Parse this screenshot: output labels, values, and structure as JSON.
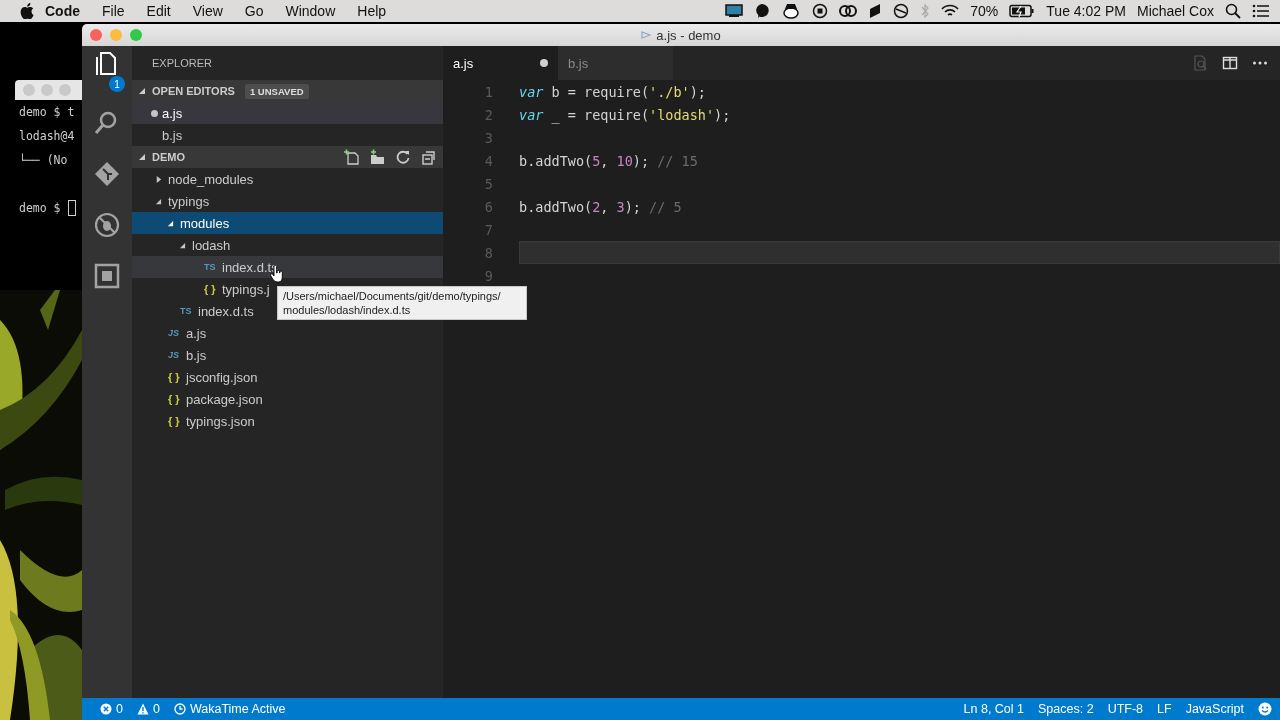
{
  "menubar": {
    "app": "Code",
    "menus": [
      "File",
      "Edit",
      "View",
      "Go",
      "Window",
      "Help"
    ],
    "battery": "70%",
    "clock": "Tue 4:02 PM",
    "user": "Michael Cox"
  },
  "terminal": {
    "lines": [
      "demo $ t",
      "lodash@4",
      "└── (No"
    ],
    "prompt": "demo $"
  },
  "window": {
    "title": "a.js - demo"
  },
  "activity_bar": {
    "items": [
      {
        "kind": "files",
        "selected": true,
        "badge": "1"
      },
      {
        "kind": "search",
        "selected": false
      },
      {
        "kind": "git",
        "selected": false
      },
      {
        "kind": "debug",
        "selected": false
      },
      {
        "kind": "extensions",
        "selected": false
      }
    ]
  },
  "sidebar": {
    "title": "EXPLORER",
    "open_editors": {
      "label": "OPEN EDITORS",
      "badge": "1 UNSAVED",
      "expanded": true,
      "items": [
        {
          "name": "a.js",
          "dirty": true,
          "selected": true
        },
        {
          "name": "b.js",
          "dirty": false,
          "selected": false
        }
      ]
    },
    "project": {
      "label": "DEMO",
      "expanded": true,
      "tree": [
        {
          "name": "node_modules",
          "kind": "folder",
          "expanded": false,
          "selected": false,
          "hovered": false
        },
        {
          "name": "typings",
          "kind": "folder",
          "expanded": true,
          "selected": false,
          "hovered": false,
          "children": [
            {
              "name": "modules",
              "kind": "folder",
              "expanded": true,
              "selected": true,
              "hovered": false,
              "children": [
                {
                  "name": "lodash",
                  "kind": "folder",
                  "expanded": true,
                  "selected": false,
                  "hovered": false,
                  "children": [
                    {
                      "name": "index.d.ts",
                      "kind": "ts",
                      "icon": "TS",
                      "selected": false,
                      "hovered": true
                    },
                    {
                      "name": "typings.j",
                      "kind": "json",
                      "icon": "{ }",
                      "selected": false,
                      "hovered": false
                    }
                  ]
                }
              ]
            },
            {
              "name": "index.d.ts",
              "kind": "ts",
              "icon": "TS",
              "selected": false,
              "hovered": false
            }
          ]
        },
        {
          "name": "a.js",
          "kind": "js",
          "icon": "JS",
          "selected": false,
          "hovered": false
        },
        {
          "name": "b.js",
          "kind": "js",
          "icon": "JS",
          "selected": false,
          "hovered": false
        },
        {
          "name": "jsconfig.json",
          "kind": "json",
          "icon": "{ }",
          "selected": false,
          "hovered": false
        },
        {
          "name": "package.json",
          "kind": "json",
          "icon": "{ }",
          "selected": false,
          "hovered": false
        },
        {
          "name": "typings.json",
          "kind": "json",
          "icon": "{ }",
          "selected": false,
          "hovered": false
        }
      ]
    }
  },
  "tooltip": {
    "lines": [
      "/Users/michael/Documents/git/demo/typings/",
      "modules/lodash/index.d.ts"
    ]
  },
  "editor": {
    "tabs": [
      {
        "label": "a.js",
        "selected": true,
        "dirty": true
      },
      {
        "label": "b.js",
        "selected": false,
        "dirty": false
      }
    ],
    "lines": [
      {
        "number": "1",
        "current": false,
        "tokens": [
          {
            "kind": "keyword",
            "text": "var"
          },
          {
            "kind": "plain",
            "text": " b = require("
          },
          {
            "kind": "string",
            "text": "'./b'"
          },
          {
            "kind": "plain",
            "text": ");"
          }
        ]
      },
      {
        "number": "2",
        "current": false,
        "tokens": [
          {
            "kind": "keyword",
            "text": "var"
          },
          {
            "kind": "plain",
            "text": " _ = require("
          },
          {
            "kind": "string",
            "text": "'lodash'"
          },
          {
            "kind": "plain",
            "text": ");"
          }
        ]
      },
      {
        "number": "3",
        "current": false
      },
      {
        "number": "4",
        "current": false,
        "tokens": [
          {
            "kind": "plain",
            "text": "b.addTwo("
          },
          {
            "kind": "number",
            "text": "5"
          },
          {
            "kind": "plain",
            "text": ", "
          },
          {
            "kind": "number",
            "text": "10"
          },
          {
            "kind": "plain",
            "text": "); "
          },
          {
            "kind": "comment",
            "text": "// 15"
          }
        ]
      },
      {
        "number": "5",
        "current": false
      },
      {
        "number": "6",
        "current": false,
        "tokens": [
          {
            "kind": "plain",
            "text": "b.addTwo("
          },
          {
            "kind": "number",
            "text": "2"
          },
          {
            "kind": "plain",
            "text": ", "
          },
          {
            "kind": "number",
            "text": "3"
          },
          {
            "kind": "plain",
            "text": "); "
          },
          {
            "kind": "comment",
            "text": "// 5"
          }
        ]
      },
      {
        "number": "7",
        "current": false
      },
      {
        "number": "8",
        "current": true
      },
      {
        "number": "9",
        "current": false
      }
    ]
  },
  "status_bar": {
    "left": [
      {
        "kind": "errors",
        "text": "0"
      },
      {
        "kind": "warnings",
        "text": "0"
      },
      {
        "kind": "wakatime",
        "text": "WakaTime Active"
      }
    ],
    "right": [
      {
        "kind": "text",
        "text": "Ln 8, Col 1"
      },
      {
        "kind": "text",
        "text": "Spaces: 2"
      },
      {
        "kind": "text",
        "text": "UTF-8"
      },
      {
        "kind": "text",
        "text": "LF"
      },
      {
        "kind": "text",
        "text": "JavaScript"
      },
      {
        "kind": "feedback"
      }
    ]
  }
}
